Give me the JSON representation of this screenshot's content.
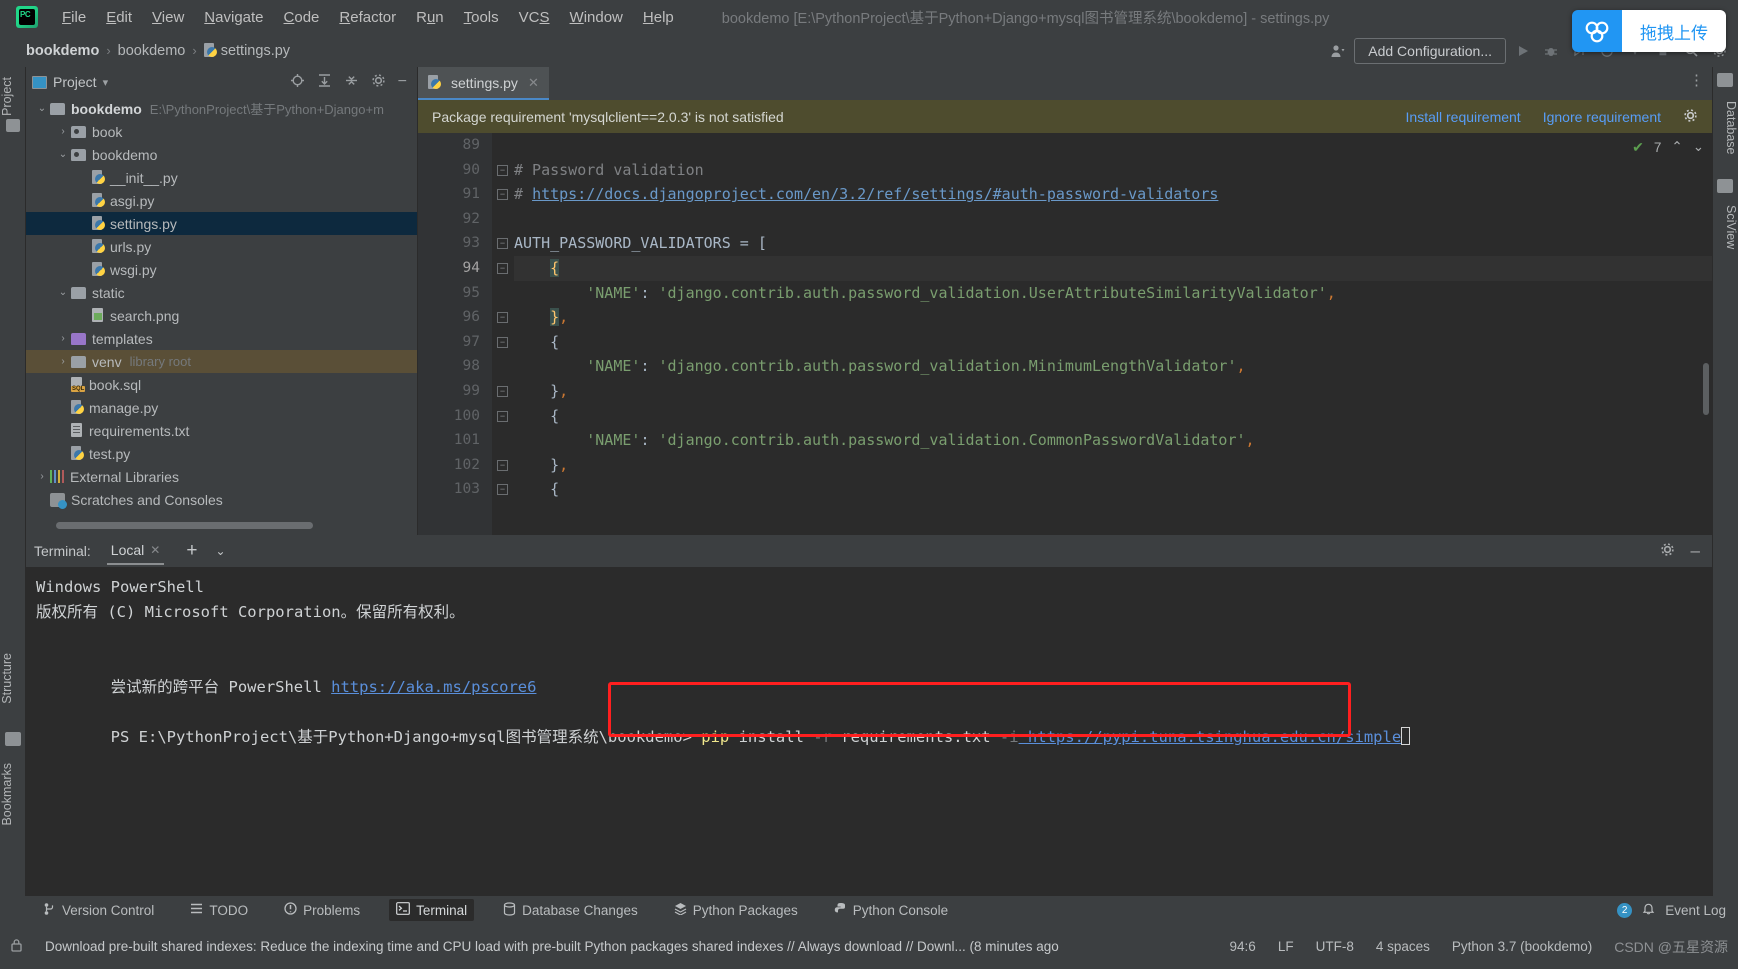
{
  "window": {
    "title": "bookdemo [E:\\PythonProject\\基于Python+Django+mysql图书管理系统\\bookdemo] - settings.py",
    "minimize": "–",
    "maximize": "□",
    "close": "✕"
  },
  "menu": {
    "logo": "pycharm-logo",
    "items": [
      "File",
      "Edit",
      "View",
      "Navigate",
      "Code",
      "Refactor",
      "Run",
      "Tools",
      "VCS",
      "Window",
      "Help"
    ]
  },
  "breadcrumb": {
    "items": [
      "bookdemo",
      "bookdemo",
      "settings.py"
    ],
    "separator": "›"
  },
  "navbar": {
    "add_configuration": "Add Configuration...",
    "run_icon": "▶",
    "debug_icon": "debug-icon",
    "coverage_icon": "coverage-icon",
    "profile_icon": "profile-icon",
    "more_icon": "▾",
    "stop_icon": "■",
    "search_icon": "search-icon",
    "settings_icon": "gear-icon",
    "user_icon": "user-icon"
  },
  "upload_popup": {
    "label": "拖拽上传",
    "icon": "cloud-upload-icon",
    "accent": "#2196f3"
  },
  "left_strip": {
    "tabs": [
      "Project",
      "Structure",
      "Bookmarks"
    ],
    "favorites_icon": "star-icon"
  },
  "right_strip": {
    "tabs": [
      "Database",
      "SciView"
    ]
  },
  "project": {
    "title": "Project",
    "dropdown_icon": "▾",
    "header_icons": [
      "locate-icon",
      "expand-all-icon",
      "collapse-all-icon",
      "gear-icon",
      "hide-icon"
    ],
    "tree": [
      {
        "indent": 0,
        "arrow": "v",
        "icon": "folder",
        "label": "bookdemo",
        "hint": "E:\\PythonProject\\基于Python+Django+m",
        "bold": true,
        "state": "none"
      },
      {
        "indent": 1,
        "arrow": ">",
        "icon": "folder-src",
        "label": "book",
        "hint": "",
        "bold": false,
        "state": "none"
      },
      {
        "indent": 1,
        "arrow": "v",
        "icon": "folder-src",
        "label": "bookdemo",
        "hint": "",
        "bold": false,
        "state": "none"
      },
      {
        "indent": 2,
        "arrow": "",
        "icon": "python-file",
        "label": "__init__.py",
        "hint": "",
        "bold": false,
        "state": "none"
      },
      {
        "indent": 2,
        "arrow": "",
        "icon": "python-file",
        "label": "asgi.py",
        "hint": "",
        "bold": false,
        "state": "none"
      },
      {
        "indent": 2,
        "arrow": "",
        "icon": "python-file",
        "label": "settings.py",
        "hint": "",
        "bold": false,
        "state": "selected"
      },
      {
        "indent": 2,
        "arrow": "",
        "icon": "python-file",
        "label": "urls.py",
        "hint": "",
        "bold": false,
        "state": "none"
      },
      {
        "indent": 2,
        "arrow": "",
        "icon": "python-file",
        "label": "wsgi.py",
        "hint": "",
        "bold": false,
        "state": "none"
      },
      {
        "indent": 1,
        "arrow": "v",
        "icon": "folder",
        "label": "static",
        "hint": "",
        "bold": false,
        "state": "none"
      },
      {
        "indent": 2,
        "arrow": "",
        "icon": "image-file",
        "label": "search.png",
        "hint": "",
        "bold": false,
        "state": "none"
      },
      {
        "indent": 1,
        "arrow": ">",
        "icon": "folder-purple",
        "label": "templates",
        "hint": "",
        "bold": false,
        "state": "none"
      },
      {
        "indent": 1,
        "arrow": ">",
        "icon": "folder",
        "label": "venv",
        "hint": "library root",
        "bold": false,
        "state": "venv"
      },
      {
        "indent": 1,
        "arrow": "",
        "icon": "sql-file",
        "label": "book.sql",
        "hint": "",
        "bold": false,
        "state": "none"
      },
      {
        "indent": 1,
        "arrow": "",
        "icon": "python-file",
        "label": "manage.py",
        "hint": "",
        "bold": false,
        "state": "none"
      },
      {
        "indent": 1,
        "arrow": "",
        "icon": "text-file",
        "label": "requirements.txt",
        "hint": "",
        "bold": false,
        "state": "none"
      },
      {
        "indent": 1,
        "arrow": "",
        "icon": "python-file",
        "label": "test.py",
        "hint": "",
        "bold": false,
        "state": "none"
      },
      {
        "indent": 0,
        "arrow": ">",
        "icon": "library",
        "label": "External Libraries",
        "hint": "",
        "bold": false,
        "state": "none"
      },
      {
        "indent": 0,
        "arrow": "",
        "icon": "scratch",
        "label": "Scratches and Consoles",
        "hint": "",
        "bold": false,
        "state": "none"
      }
    ]
  },
  "editor": {
    "tab": {
      "label": "settings.py",
      "close": "✕",
      "icon": "python-file"
    },
    "kebab_icon": "⋮",
    "notification": {
      "message": "Package requirement 'mysqlclient==2.0.3' is not satisfied",
      "install_label": "Install requirement",
      "ignore_label": "Ignore requirement",
      "gear_icon": "gear-icon"
    },
    "inspections": {
      "count": "7",
      "ok_icon": "✔",
      "up_icon": "⌃",
      "down_icon": "⌄"
    },
    "first_line_number": 89,
    "current_line": 94,
    "lines": [
      {
        "n": 89,
        "fold": "",
        "text": "",
        "type": "blank"
      },
      {
        "n": 90,
        "fold": "-",
        "text": "# Password validation",
        "type": "comment"
      },
      {
        "n": 91,
        "fold": "-",
        "text": "# https://docs.djangoproject.com/en/3.2/ref/settings/#auth-password-validators",
        "type": "comment-link"
      },
      {
        "n": 92,
        "fold": "",
        "text": "",
        "type": "blank"
      },
      {
        "n": 93,
        "fold": "-",
        "text": "AUTH_PASSWORD_VALIDATORS = [",
        "type": "code"
      },
      {
        "n": 94,
        "fold": "-",
        "text": "    {",
        "type": "brace-open-hl"
      },
      {
        "n": 95,
        "fold": "",
        "text": "        'NAME': 'django.contrib.auth.password_validation.UserAttributeSimilarityValidator',",
        "type": "str-line"
      },
      {
        "n": 96,
        "fold": "-",
        "text": "    },",
        "type": "brace-close-hl"
      },
      {
        "n": 97,
        "fold": "-",
        "text": "    {",
        "type": "code"
      },
      {
        "n": 98,
        "fold": "",
        "text": "        'NAME': 'django.contrib.auth.password_validation.MinimumLengthValidator',",
        "type": "str-line"
      },
      {
        "n": 99,
        "fold": "-",
        "text": "    },",
        "type": "code"
      },
      {
        "n": 100,
        "fold": "-",
        "text": "    {",
        "type": "code"
      },
      {
        "n": 101,
        "fold": "",
        "text": "        'NAME': 'django.contrib.auth.password_validation.CommonPasswordValidator',",
        "type": "str-line"
      },
      {
        "n": 102,
        "fold": "-",
        "text": "    },",
        "type": "code"
      },
      {
        "n": 103,
        "fold": "-",
        "text": "    {",
        "type": "code"
      }
    ]
  },
  "terminal": {
    "label": "Terminal:",
    "tab": "Local",
    "tab_close": "✕",
    "add_icon": "+",
    "dropdown_icon": "⌄",
    "settings_icon": "gear-icon",
    "hide_icon": "–",
    "lines": [
      "Windows PowerShell",
      "版权所有 (C) Microsoft Corporation。保留所有权利。",
      "",
      "尝试新的跨平台 PowerShell https://aka.ms/pscore6",
      ""
    ],
    "link_line_prefix": "尝试新的跨平台 PowerShell ",
    "link_url": "https://aka.ms/pscore6",
    "prompt": "PS E:\\PythonProject\\基于Python+Django+mysql图书管理系统\\bookdemo> ",
    "command": {
      "cmd": "pip",
      "sub": " install ",
      "flag_r": "-r",
      "file": " requirements.txt ",
      "flag_i": "-i",
      "index_url": " https://pypi.tuna.tsinghua.edu.cn/simple"
    },
    "highlight_color": "#ff1f1f"
  },
  "bottom_bar": {
    "items": [
      {
        "label": "Version Control",
        "icon": "branch-icon",
        "active": false
      },
      {
        "label": "TODO",
        "icon": "list-icon",
        "active": false
      },
      {
        "label": "Problems",
        "icon": "warning-icon",
        "active": false
      },
      {
        "label": "Terminal",
        "icon": "terminal-icon",
        "active": true
      },
      {
        "label": "Database Changes",
        "icon": "database-icon",
        "active": false
      },
      {
        "label": "Python Packages",
        "icon": "packages-icon",
        "active": false
      },
      {
        "label": "Python Console",
        "icon": "python-icon",
        "active": false
      }
    ],
    "event_log": {
      "label": "Event Log",
      "count": "2",
      "icon": "bell-icon"
    }
  },
  "status_bar": {
    "message": "Download pre-built shared indexes: Reduce the indexing time and CPU load with pre-built Python packages shared indexes // Always download // Downl... (8 minutes ago",
    "caret_position": "94:6",
    "line_separator": "LF",
    "encoding": "UTF-8",
    "indent": "4 spaces",
    "interpreter": "Python 3.7 (bookdemo)",
    "watermark": "CSDN @五星资源",
    "lock_icon": "lock-icon"
  }
}
